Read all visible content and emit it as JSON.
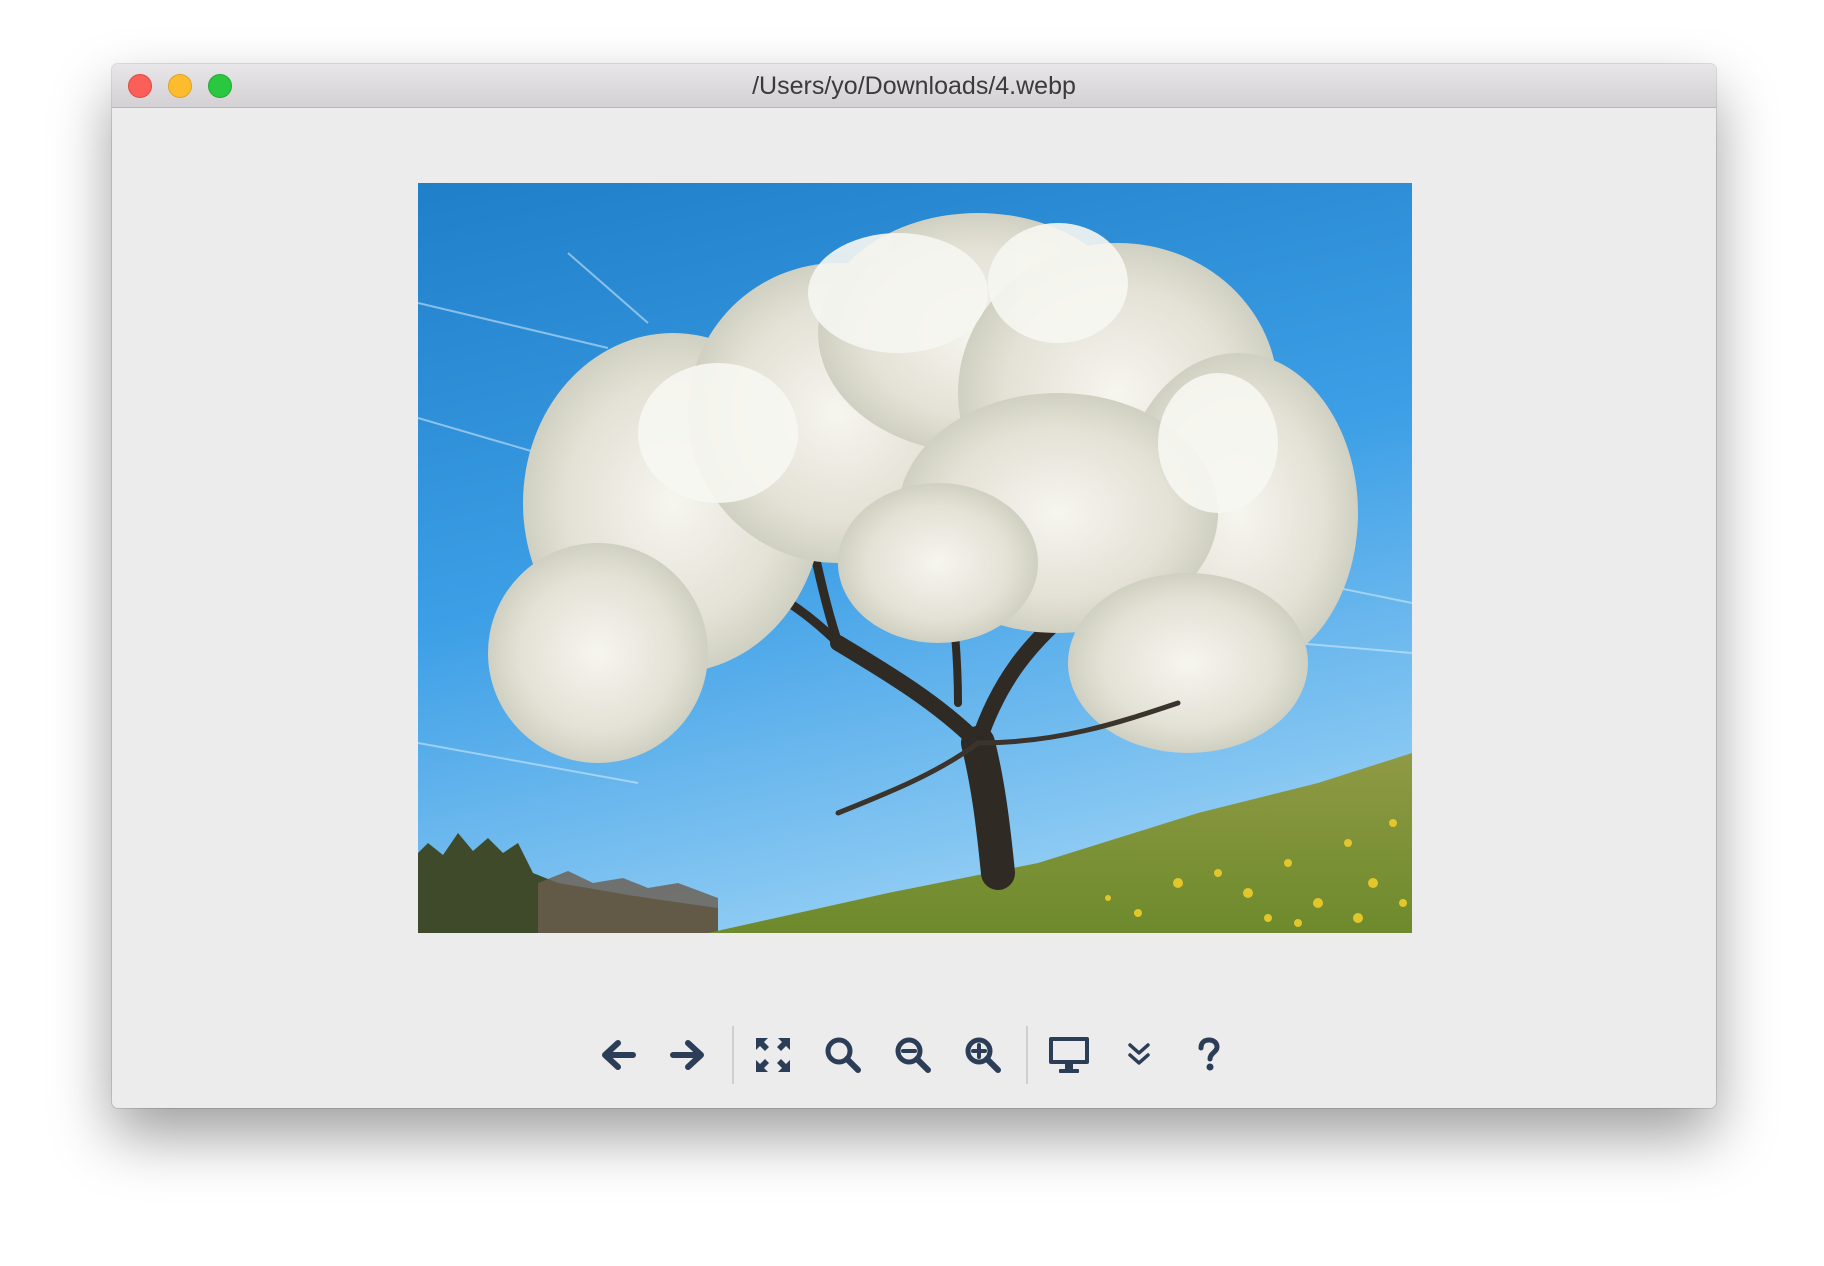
{
  "window": {
    "title": "/Users/yo/Downloads/4.webp"
  },
  "traffic_lights": {
    "close_color": "#fc5f57",
    "minimize_color": "#fdbc2e",
    "maximize_color": "#2ac841"
  },
  "image": {
    "subject": "blossoming tree on grassy hillside under blue sky"
  },
  "toolbar": {
    "icon_color": "#2c3e57",
    "buttons": [
      {
        "icon": "arrow-left-icon"
      },
      {
        "icon": "arrow-right-icon"
      },
      {
        "icon": "fit-screen-icon"
      },
      {
        "icon": "magnifier-icon"
      },
      {
        "icon": "zoom-out-icon"
      },
      {
        "icon": "zoom-in-icon"
      },
      {
        "icon": "monitor-icon"
      },
      {
        "icon": "chevron-double-down-icon"
      },
      {
        "icon": "question-mark-icon"
      }
    ]
  }
}
